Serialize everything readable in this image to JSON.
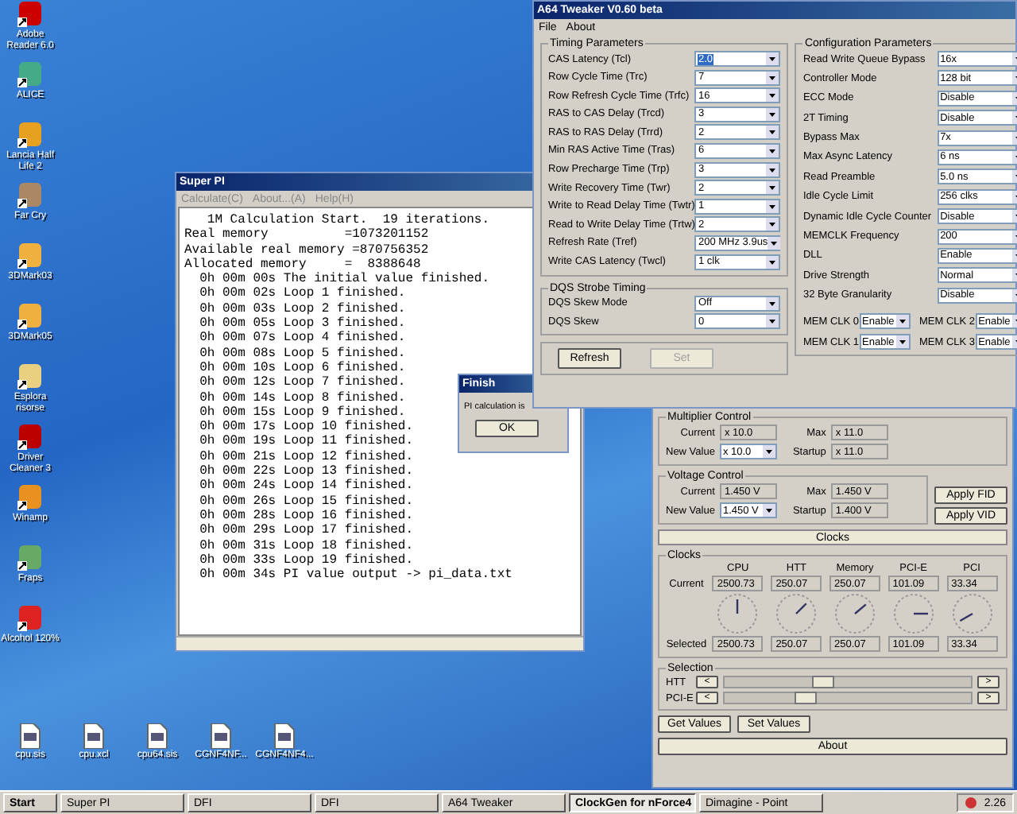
{
  "desktop_icons": [
    {
      "label": "Adobe Reader 6.0"
    },
    {
      "label": "ALICE"
    },
    {
      "label": "Lancia Half Life 2"
    },
    {
      "label": "Far Cry"
    },
    {
      "label": "3DMark03"
    },
    {
      "label": "3DMark05"
    },
    {
      "label": "Esplora risorse"
    },
    {
      "label": "Driver Cleaner 3"
    },
    {
      "label": "Winamp"
    },
    {
      "label": "Fraps"
    },
    {
      "label": "Alcohol 120%"
    }
  ],
  "desktop_files": [
    {
      "label": "cpu.sis"
    },
    {
      "label": "cpu.xcl"
    },
    {
      "label": "cpu64.sis"
    },
    {
      "label": "CGNF4NF..."
    },
    {
      "label": "CGNF4NF4..."
    }
  ],
  "super_pi": {
    "title": "Super PI",
    "menu": [
      "Calculate(C)",
      "About...(A)",
      "Help(H)"
    ],
    "lines": [
      "   1M Calculation Start.  19 iterations.",
      "Real memory          =1073201152",
      "Available real memory =870756352",
      "Allocated memory     =  8388648",
      "  0h 00m 00s The initial value finished.",
      "  0h 00m 02s Loop 1 finished.",
      "  0h 00m 03s Loop 2 finished.",
      "  0h 00m 05s Loop 3 finished.",
      "  0h 00m 07s Loop 4 finished.",
      "  0h 00m 08s Loop 5 finished.",
      "  0h 00m 10s Loop 6 finished.",
      "  0h 00m 12s Loop 7 finished.",
      "  0h 00m 14s Loop 8 finished.",
      "  0h 00m 15s Loop 9 finished.",
      "  0h 00m 17s Loop 10 finished.",
      "  0h 00m 19s Loop 11 finished.",
      "  0h 00m 21s Loop 12 finished.",
      "  0h 00m 22s Loop 13 finished.",
      "  0h 00m 24s Loop 14 finished.",
      "  0h 00m 26s Loop 15 finished.",
      "  0h 00m 28s Loop 16 finished.",
      "  0h 00m 29s Loop 17 finished.",
      "  0h 00m 31s Loop 18 finished.",
      "  0h 00m 33s Loop 19 finished.",
      "  0h 00m 34s PI value output -> pi_data.txt"
    ]
  },
  "finish_dialog": {
    "title": "Finish",
    "message": "PI calculation is",
    "button": "OK"
  },
  "a64_tweaker": {
    "title": "A64 Tweaker V0.60 beta",
    "menu": [
      "File",
      "About"
    ],
    "timing": {
      "title": "Timing Parameters",
      "fields": [
        {
          "label": "CAS Latency (Tcl)",
          "value": "2.0",
          "focused": true
        },
        {
          "label": "Row Cycle Time (Trc)",
          "value": "7",
          "focused": false
        },
        {
          "label": "Row Refresh Cycle Time (Trfc)",
          "value": "16",
          "focused": false
        },
        {
          "label": "RAS to CAS Delay (Trcd)",
          "value": "3",
          "focused": false
        },
        {
          "label": "RAS to RAS Delay (Trrd)",
          "value": "2",
          "focused": false
        },
        {
          "label": "Min RAS Active Time (Tras)",
          "value": "6",
          "focused": false
        },
        {
          "label": "Row Precharge Time (Trp)",
          "value": "3",
          "focused": false
        },
        {
          "label": "Write Recovery Time (Twr)",
          "value": "2",
          "focused": false
        },
        {
          "label": "Write to Read Delay Time (Twtr)",
          "value": "1",
          "focused": false
        },
        {
          "label": "Read to Write Delay Time (Trtw)",
          "value": "2",
          "focused": false
        },
        {
          "label": "Refresh Rate (Tref)",
          "value": "200 MHz 3.9us",
          "focused": false
        },
        {
          "label": "Write CAS Latency (Twcl)",
          "value": "1 clk",
          "focused": false
        }
      ]
    },
    "dqs": {
      "title": "DQS Strobe Timing",
      "fields": [
        {
          "label": "DQS Skew Mode",
          "value": "Off",
          "focused": false
        },
        {
          "label": "DQS Skew",
          "value": "0",
          "focused": false
        }
      ]
    },
    "config": {
      "title": "Configuration Parameters",
      "fields": [
        {
          "label": "Read Write Queue Bypass",
          "value": "16x"
        },
        {
          "label": "Controller Mode",
          "value": "128 bit"
        },
        {
          "label": "ECC Mode",
          "value": "Disable"
        },
        {
          "label": "2T Timing",
          "value": "Disable"
        },
        {
          "label": "Bypass Max",
          "value": "7x"
        },
        {
          "label": "Max Async Latency",
          "value": "6 ns"
        },
        {
          "label": "Read Preamble",
          "value": "5.0 ns"
        },
        {
          "label": "Idle Cycle Limit",
          "value": "256 clks"
        },
        {
          "label": "Dynamic Idle Cycle Counter",
          "value": "Disable"
        },
        {
          "label": "MEMCLK Frequency",
          "value": "200"
        },
        {
          "label": "DLL",
          "value": "Enable"
        },
        {
          "label": "Drive Strength",
          "value": "Normal"
        },
        {
          "label": "32 Byte Granularity",
          "value": "Disable"
        }
      ]
    },
    "mem_clks": [
      {
        "label": "MEM CLK 0",
        "value": "Enable"
      },
      {
        "label": "MEM CLK 2",
        "value": "Enable"
      },
      {
        "label": "MEM CLK 1",
        "value": "Enable"
      },
      {
        "label": "MEM CLK 3",
        "value": "Enable"
      }
    ],
    "buttons": [
      {
        "label": "Refresh",
        "disabled": false
      },
      {
        "label": "Set",
        "disabled": true
      }
    ]
  },
  "clockgen": {
    "multiplier": {
      "title": "Multiplier Control",
      "current_label": "Current",
      "current": "x 10.0",
      "new_label": "New Value",
      "new_value": "x 10.0",
      "max_label": "Max",
      "max": "x 11.0",
      "startup_label": "Startup",
      "startup": "x 11.0"
    },
    "voltage": {
      "title": "Voltage Control",
      "current_label": "Current",
      "current": "1.450 V",
      "new_label": "New Value",
      "new_value": "1.450 V",
      "max_label": "Max",
      "max": "1.450 V",
      "startup_label": "Startup",
      "startup": "1.400 V"
    },
    "apply_buttons": [
      "Apply FID",
      "Apply VID"
    ],
    "clocks_tab": "Clocks",
    "clocks": {
      "title": "Clocks",
      "row_labels": [
        "Current",
        "Selected"
      ],
      "columns": [
        {
          "name": "CPU",
          "current": "2500.73",
          "selected": "2500.73"
        },
        {
          "name": "HTT",
          "current": "250.07",
          "selected": "250.07"
        },
        {
          "name": "Memory",
          "current": "250.07",
          "selected": "250.07"
        },
        {
          "name": "PCI-E",
          "current": "101.09",
          "selected": "101.09"
        },
        {
          "name": "PCI",
          "current": "33.34",
          "selected": "33.34"
        }
      ]
    },
    "selection": {
      "title": "Selection",
      "sliders": [
        {
          "label": "HTT",
          "level": 0.4,
          "left": "<",
          "right": ">"
        },
        {
          "label": "PCI-E",
          "level": 0.33,
          "left": "<",
          "right": ">"
        }
      ]
    },
    "buttons": [
      "Get Values",
      "Set Values"
    ],
    "about": "About"
  },
  "taskbar": {
    "start": "Start",
    "tasks": [
      {
        "label": "Super PI",
        "selected": false
      },
      {
        "label": "DFI",
        "selected": false
      },
      {
        "label": "DFI",
        "selected": false
      },
      {
        "label": "A64 Tweaker",
        "selected": false
      },
      {
        "label": "ClockGen for nForce4",
        "selected": true
      },
      {
        "label": "Dimagine - Point",
        "selected": false
      }
    ],
    "clock": "2.26"
  }
}
